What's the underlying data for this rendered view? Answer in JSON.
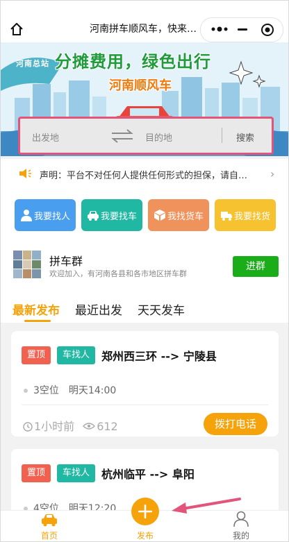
{
  "nav": {
    "title": "河南拼车顺风车，快来加入拼车群吧！"
  },
  "banner": {
    "city_label": "河南总站",
    "headline": "分摊费用，绿色出行",
    "subheadline": "河南顺风车"
  },
  "search": {
    "from_placeholder": "出发地",
    "to_placeholder": "目的地",
    "search_label": "搜索"
  },
  "notice": {
    "text": "声明：平台不对任何人提供任何形式的担保，请自行核实"
  },
  "actions": [
    {
      "label": "我要找人",
      "icon": "person-icon",
      "color": "#4a9ef0"
    },
    {
      "label": "我要找车",
      "icon": "car-icon",
      "color": "#20b7a3"
    },
    {
      "label": "我找货车",
      "icon": "box-icon",
      "color": "#f0925b"
    },
    {
      "label": "我要找货",
      "icon": "truck-icon",
      "color": "#f6c230"
    }
  ],
  "group": {
    "name": "拼车群",
    "description": "欢迎加入，有河南各县和各市地区拼车群",
    "join_label": "进群"
  },
  "tabs": [
    {
      "label": "最新发布",
      "active": true
    },
    {
      "label": "最近出发",
      "active": false
    },
    {
      "label": "天天发车",
      "active": false
    }
  ],
  "posts": [
    {
      "top_tag": "置顶",
      "kind_tag": "车找人",
      "route": "郑州西三环 --> 宁陵县",
      "seats": "3空位",
      "departure": "明天14:00",
      "posted": "1小时前",
      "views": "612",
      "call_label": "拨打电话"
    },
    {
      "top_tag": "置顶",
      "kind_tag": "车找人",
      "route": "杭州临平 --> 阜阳",
      "seats": "4空位",
      "departure": "明天12:20"
    }
  ],
  "bottom_nav": [
    {
      "label": "首页",
      "icon": "car-icon"
    },
    {
      "label": "发布",
      "icon": "plus-icon"
    },
    {
      "label": "我的",
      "icon": "user-icon"
    }
  ],
  "colors": {
    "accent": "#f5a20b",
    "search_highlight": "#e3547a",
    "join_green": "#1aad19"
  }
}
